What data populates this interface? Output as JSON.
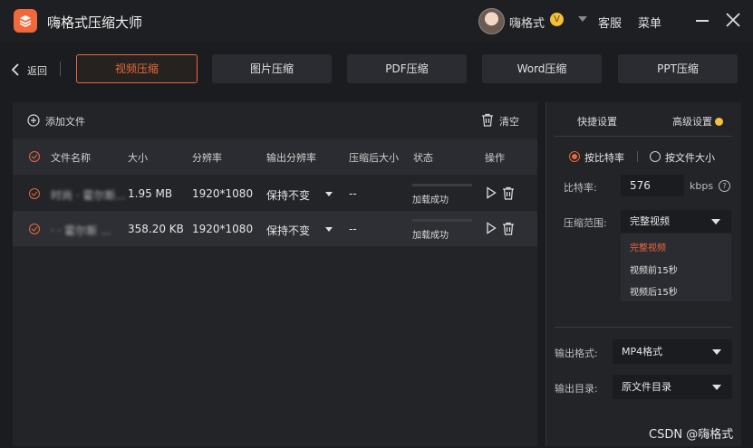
{
  "app": {
    "title": "嗨格式压缩大师",
    "username": "嗨格式",
    "vip_badge": "V",
    "service_label": "客服",
    "menu_label": "菜单",
    "accent_color": "#e8693e"
  },
  "nav": {
    "back_label": "返回",
    "tabs": [
      {
        "label": "视频压缩",
        "active": true
      },
      {
        "label": "图片压缩",
        "active": false
      },
      {
        "label": "PDF压缩",
        "active": false
      },
      {
        "label": "Word压缩",
        "active": false
      },
      {
        "label": "PPT压缩",
        "active": false
      }
    ]
  },
  "filelist": {
    "add_label": "添加文件",
    "clear_label": "清空",
    "columns": [
      "文件名称",
      "大小",
      "分辨率",
      "输出分辨率",
      "压缩后大小",
      "状态",
      "操作"
    ],
    "rows": [
      {
        "name": "\u0000",
        "name_display": "时尚 · 霍尔斯...",
        "size": "1.95 MB",
        "resolution": "1920*1080",
        "output_resolution": "保持不变",
        "compressed_size": "--",
        "status": "加载成功"
      },
      {
        "name_display": "· · 霍尔斯 ...",
        "size": "358.20 KB",
        "resolution": "1920*1080",
        "output_resolution": "保持不变",
        "compressed_size": "--",
        "status": "加载成功"
      }
    ]
  },
  "settings": {
    "tab_quick": "快捷设置",
    "tab_advanced": "高级设置",
    "mode_bitrate": "按比特率",
    "mode_filesize": "按文件大小",
    "bitrate_label": "比特率:",
    "bitrate_value": "576",
    "bitrate_unit": "kbps",
    "help_icon": "?",
    "range_label": "压缩范围:",
    "range_value": "完整视频",
    "range_options": [
      "完整视频",
      "视频前15秒",
      "视频后15秒"
    ],
    "format_label": "输出格式:",
    "format_value": "MP4格式",
    "dir_label": "输出目录:",
    "dir_value": "原文件目录"
  },
  "watermark": "CSDN @嗨格式"
}
